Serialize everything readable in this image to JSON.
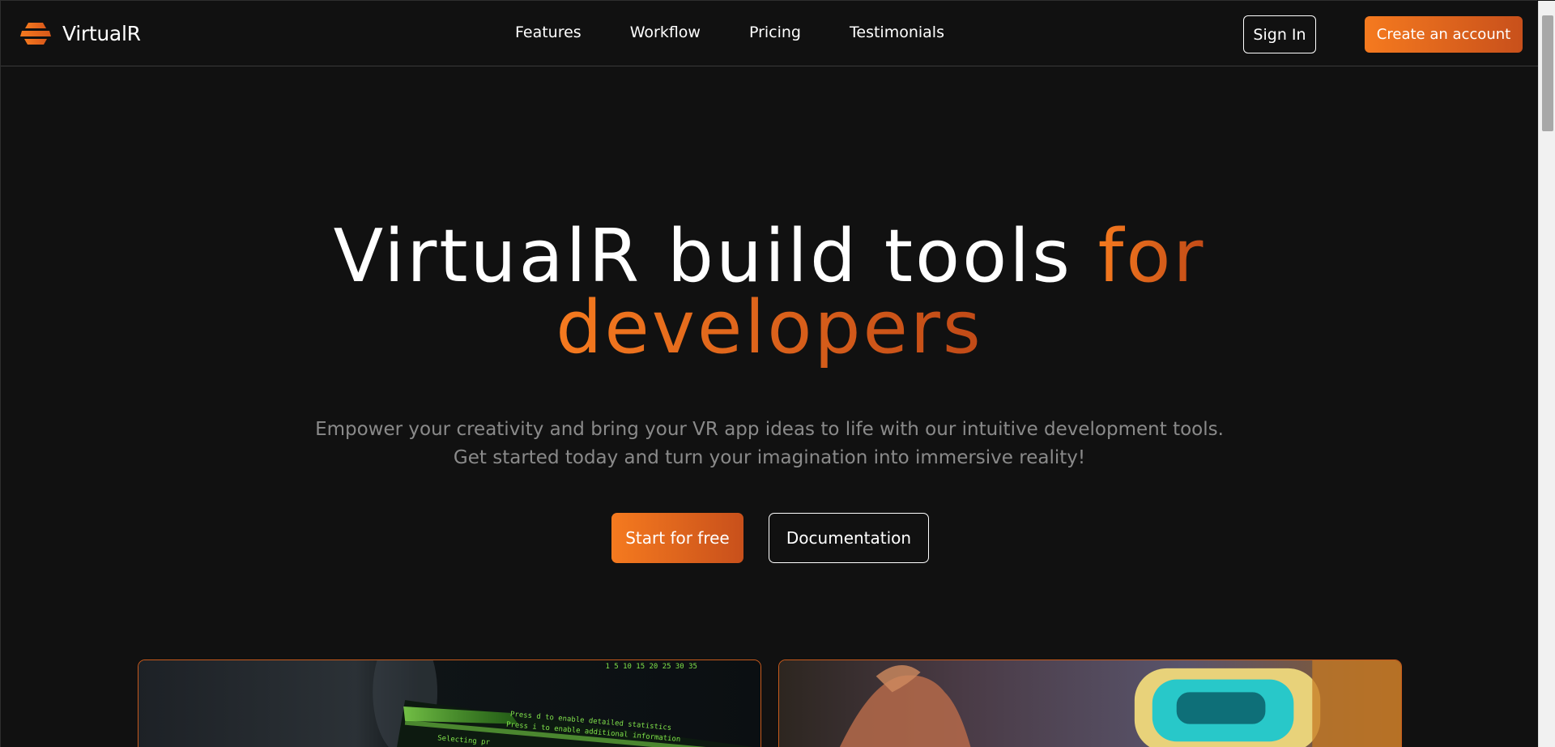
{
  "brand": {
    "name": "VirtualR",
    "logo_icon": "virtualr-logo-icon",
    "accent_color": "#f57a1f"
  },
  "nav": {
    "links": [
      "Features",
      "Workflow",
      "Pricing",
      "Testimonials"
    ],
    "sign_in": "Sign In",
    "create_account": "Create an account"
  },
  "hero": {
    "title_white": "VirtualR build tools",
    "title_accent_1": "for",
    "title_accent_2": "developers",
    "subtitle_line1": "Empower your creativity and bring your VR app ideas to life with our intuitive development tools.",
    "subtitle_line2": "Get started today and turn your imagination into immersive reality!",
    "primary_cta": "Start for free",
    "secondary_cta": "Documentation"
  },
  "cards": [
    {
      "image": "code-screen-image",
      "overlay_lines": [
        "Press d to enable detailed statistics",
        "Press i to enable additional information",
        "Selecting pr"
      ],
      "scale_numbers": "1 5 10 15 20 25 30 35"
    },
    {
      "image": "vr-headset-image"
    }
  ]
}
